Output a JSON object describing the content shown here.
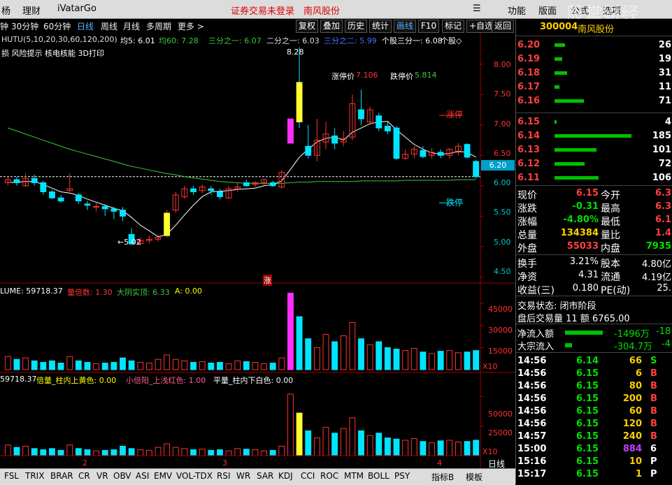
{
  "window": {
    "menu_left": [
      "杨",
      "理财",
      "iVatarGo"
    ],
    "menu_center": [
      "证券交易未登录",
      "南风股份"
    ],
    "menu_right": [
      "功能",
      "版面",
      "公式",
      "选项"
    ],
    "watermark": "股掌财经"
  },
  "toolbar": {
    "periods": [
      "钟",
      "30分钟",
      "60分钟",
      "日线",
      "周线",
      "月线",
      "多周期",
      "更多 >"
    ],
    "active_period": "日线",
    "buttons": [
      "复权",
      "叠加",
      "历史",
      "统计",
      "画线",
      "F10",
      "标记",
      "+自选",
      "返回"
    ],
    "active_button": "画线"
  },
  "main_chart": {
    "indicator_line": "HUTU(5,10,20,30,60,120,200)",
    "ma5": "均5: 6.01",
    "ma60": "均60: 7.28",
    "third1": "三分之一: 6.07",
    "third2": "二分之一: 6.03",
    "third3": "三分之二: 5.99",
    "individual": "个股三分一: 6.08",
    "individual2": "个股◇",
    "risk_line": "损 风险提示 核电核能 3D打印",
    "limit_up_price_label": "涨停价",
    "limit_up_price": "7.106",
    "limit_down_price_label": "跌停价",
    "limit_down_price": "5.814",
    "high_label": "8.28",
    "low_label": "←5.02",
    "limit_up_tag": "涨停",
    "limit_down_tag": "跌停",
    "current_price_tag": "6.20",
    "zhang_tag": "涨",
    "y_ticks": [
      "8.00",
      "7.50",
      "7.00",
      "6.50",
      "6.00",
      "5.50",
      "5.00",
      "4.50"
    ]
  },
  "volume_chart": {
    "title": "LUME: 59718.37",
    "multiple": "量倍数: 1.30",
    "real_body": "大阴实顶: 6.33",
    "a": "A: 0.00",
    "y_ticks": [
      "45000",
      "30000",
      "15000"
    ],
    "unit": "X10"
  },
  "third_chart": {
    "title": "59718.37",
    "beiliang": "倍量_柱内上黄色: 0.00",
    "xiaobei": "小倍阳_上浅红色: 1.00",
    "pingliang": "平量_柱内下白色: 0.00",
    "y_ticks": [
      "50000",
      "25000"
    ],
    "unit": "X10",
    "month_marks": [
      "2",
      "3",
      "4"
    ],
    "daily_label": "日线"
  },
  "bottom_tabs": [
    "FSL",
    "TRIX",
    "BRAR",
    "CR",
    "VR",
    "OBV",
    "ASI",
    "EMV",
    "VOL-TDX",
    "RSI",
    "WR",
    "SAR",
    "KDJ",
    "CCI",
    "ROC",
    "MTM",
    "BOLL",
    "PSY",
    "指标B",
    "模板"
  ],
  "quote": {
    "code": "300004",
    "name": "南风股份",
    "sell": [
      {
        "price": "6.20",
        "vol": "26"
      },
      {
        "price": "6.19",
        "vol": "19"
      },
      {
        "price": "6.18",
        "vol": "31"
      },
      {
        "price": "6.17",
        "vol": "11"
      },
      {
        "price": "6.16",
        "vol": "71"
      }
    ],
    "buy": [
      {
        "price": "6.15",
        "vol": "4"
      },
      {
        "price": "6.14",
        "vol": "185"
      },
      {
        "price": "6.13",
        "vol": "101"
      },
      {
        "price": "6.12",
        "vol": "72"
      },
      {
        "price": "6.11",
        "vol": "106"
      }
    ],
    "stats": [
      {
        "k1": "现价",
        "v1": "6.15",
        "k2": "今开",
        "v2": "6.3"
      },
      {
        "k1": "涨跌",
        "v1": "-0.31",
        "k2": "最高",
        "v2": "6.3"
      },
      {
        "k1": "涨幅",
        "v1": "-4.80%",
        "k2": "最低",
        "v2": "6.1"
      },
      {
        "k1": "总量",
        "v1": "134384",
        "k2": "量比",
        "v2": "1.4"
      },
      {
        "k1": "外盘",
        "v1": "55033",
        "k2": "内盘",
        "v2": "7935"
      }
    ],
    "stats2": [
      {
        "k1": "换手",
        "v1": "3.21%",
        "k2": "股本",
        "v2": "4.80亿"
      },
      {
        "k1": "净资",
        "v1": "4.31",
        "k2": "流通",
        "v2": "4.19亿"
      },
      {
        "k1": "收益(三)",
        "v1": "0.180",
        "k2": "PE(动)",
        "v2": "25."
      }
    ],
    "status": "交易状态: 闭市阶段",
    "after_hours": "盘后交易量 11 额 6765.00",
    "net_inflow_label": "净流入额",
    "net_inflow": "-1496万",
    "net_inflow2": "-18",
    "block_label": "大宗流入",
    "block_inflow": "-304.7万",
    "block_inflow2": "-4",
    "ticks": [
      {
        "t": "14:56",
        "p": "6.14",
        "v": "66",
        "s": "S"
      },
      {
        "t": "14:56",
        "p": "6.15",
        "v": "6",
        "s": "B"
      },
      {
        "t": "14:56",
        "p": "6.15",
        "v": "80",
        "s": "B"
      },
      {
        "t": "14:56",
        "p": "6.15",
        "v": "200",
        "s": "B"
      },
      {
        "t": "14:56",
        "p": "6.15",
        "v": "60",
        "s": "B"
      },
      {
        "t": "14:56",
        "p": "6.15",
        "v": "120",
        "s": "B"
      },
      {
        "t": "14:57",
        "p": "6.15",
        "v": "240",
        "s": "B"
      },
      {
        "t": "15:00",
        "p": "6.15",
        "v": "884",
        "s": "6"
      },
      {
        "t": "15:16",
        "p": "6.15",
        "v": "10",
        "s": "P"
      },
      {
        "t": "15:17",
        "p": "6.15",
        "v": "1",
        "s": "P"
      }
    ]
  },
  "colors": {
    "up": "#ff3232",
    "down": "#00e5ff",
    "ma_white": "#ffffff",
    "ma_green": "#3cc83c",
    "price_red": "#ff4040",
    "price_green": "#00d000",
    "bar_green": "#00c000"
  },
  "chart_data": {
    "type": "candlestick",
    "candles": [
      {
        "o": 6.05,
        "c": 6.1,
        "h": 6.15,
        "l": 6.0
      },
      {
        "o": 6.1,
        "c": 6.05,
        "h": 6.15,
        "l": 6.0
      },
      {
        "o": 6.0,
        "c": 6.12,
        "h": 6.2,
        "l": 5.98
      },
      {
        "o": 6.12,
        "c": 6.05,
        "h": 6.18,
        "l": 6.0
      },
      {
        "o": 6.05,
        "c": 5.9,
        "h": 6.08,
        "l": 5.85
      },
      {
        "o": 5.9,
        "c": 5.8,
        "h": 5.93,
        "l": 5.78
      },
      {
        "o": 5.8,
        "c": 5.75,
        "h": 5.85,
        "l": 5.72
      },
      {
        "o": 5.92,
        "c": 5.95,
        "h": 6.2,
        "l": 5.9
      },
      {
        "o": 5.85,
        "c": 5.75,
        "h": 5.88,
        "l": 5.7
      },
      {
        "o": 5.7,
        "c": 5.68,
        "h": 5.75,
        "l": 5.6
      },
      {
        "o": 5.65,
        "c": 5.66,
        "h": 5.72,
        "l": 5.58
      },
      {
        "o": 5.66,
        "c": 5.62,
        "h": 5.7,
        "l": 5.5
      },
      {
        "o": 5.62,
        "c": 5.58,
        "h": 5.65,
        "l": 5.45
      },
      {
        "o": 5.6,
        "c": 5.5,
        "h": 5.65,
        "l": 5.42
      },
      {
        "o": 5.2,
        "c": 5.05,
        "h": 5.3,
        "l": 5.02
      },
      {
        "o": 5.05,
        "c": 5.1,
        "h": 5.15,
        "l": 5.02
      },
      {
        "o": 5.1,
        "c": 5.12,
        "h": 5.18,
        "l": 5.05
      },
      {
        "o": 5.12,
        "c": 5.15,
        "h": 5.2,
        "l": 5.08
      },
      {
        "o": 5.18,
        "c": 5.55,
        "h": 5.6,
        "l": 5.15
      },
      {
        "o": 5.6,
        "c": 5.85,
        "h": 5.9,
        "l": 5.55
      },
      {
        "o": 5.82,
        "c": 5.95,
        "h": 6.0,
        "l": 5.78
      },
      {
        "o": 5.95,
        "c": 5.9,
        "h": 6.0,
        "l": 5.85
      },
      {
        "o": 5.92,
        "c": 5.98,
        "h": 6.02,
        "l": 5.88
      },
      {
        "o": 5.95,
        "c": 5.92,
        "h": 6.0,
        "l": 5.85
      },
      {
        "o": 5.9,
        "c": 5.82,
        "h": 5.95,
        "l": 5.78
      },
      {
        "o": 5.8,
        "c": 5.95,
        "h": 6.0,
        "l": 5.78
      },
      {
        "o": 5.95,
        "c": 5.98,
        "h": 6.05,
        "l": 5.9
      },
      {
        "o": 6.05,
        "c": 6.0,
        "h": 6.1,
        "l": 5.98
      },
      {
        "o": 6.02,
        "c": 6.05,
        "h": 6.08,
        "l": 5.98
      },
      {
        "o": 6.05,
        "c": 6.1,
        "h": 6.12,
        "l": 6.0
      },
      {
        "o": 6.05,
        "c": 6.0,
        "h": 6.08,
        "l": 5.98
      },
      {
        "o": 5.98,
        "c": 6.22,
        "h": 6.25,
        "l": 5.95
      },
      {
        "o": 6.7,
        "c": 7.1,
        "h": 7.1,
        "l": 6.7
      },
      {
        "o": 7.7,
        "c": 7.05,
        "h": 8.28,
        "l": 6.95
      },
      {
        "o": 6.65,
        "c": 6.5,
        "h": 7.0,
        "l": 6.45
      },
      {
        "o": 6.5,
        "c": 6.75,
        "h": 7.1,
        "l": 6.4
      },
      {
        "o": 6.72,
        "c": 6.85,
        "h": 7.05,
        "l": 6.6
      },
      {
        "o": 6.82,
        "c": 6.7,
        "h": 6.95,
        "l": 6.6
      },
      {
        "o": 6.72,
        "c": 6.78,
        "h": 6.9,
        "l": 6.65
      },
      {
        "o": 6.8,
        "c": 7.35,
        "h": 7.5,
        "l": 6.75
      },
      {
        "o": 7.25,
        "c": 7.1,
        "h": 7.58,
        "l": 7.0
      },
      {
        "o": 7.05,
        "c": 7.25,
        "h": 7.3,
        "l": 7.0
      },
      {
        "o": 7.15,
        "c": 6.95,
        "h": 7.2,
        "l": 6.9
      },
      {
        "o": 6.98,
        "c": 6.9,
        "h": 7.05,
        "l": 6.85
      },
      {
        "o": 6.95,
        "c": 6.45,
        "h": 6.98,
        "l": 6.42
      },
      {
        "o": 6.45,
        "c": 6.52,
        "h": 6.6,
        "l": 6.42
      },
      {
        "o": 6.52,
        "c": 6.6,
        "h": 6.65,
        "l": 6.45
      },
      {
        "o": 6.58,
        "c": 6.48,
        "h": 6.65,
        "l": 6.45
      },
      {
        "o": 6.5,
        "c": 6.55,
        "h": 6.62,
        "l": 6.45
      },
      {
        "o": 6.55,
        "c": 6.5,
        "h": 6.6,
        "l": 6.45
      },
      {
        "o": 6.5,
        "c": 6.6,
        "h": 6.62,
        "l": 6.45
      },
      {
        "o": 6.55,
        "c": 6.65,
        "h": 6.7,
        "l": 6.5
      },
      {
        "o": 6.68,
        "c": 6.47,
        "h": 6.7,
        "l": 6.45
      },
      {
        "o": 6.4,
        "c": 6.15,
        "h": 6.42,
        "l": 6.12
      }
    ],
    "ma5": [
      6.05,
      6.06,
      6.07,
      6.07,
      6.02,
      5.96,
      5.9,
      5.88,
      5.84,
      5.78,
      5.73,
      5.68,
      5.63,
      5.59,
      5.48,
      5.35,
      5.26,
      5.16,
      5.2,
      5.35,
      5.52,
      5.68,
      5.82,
      5.9,
      5.91,
      5.92,
      5.94,
      5.95,
      5.96,
      6.0,
      6.02,
      6.08,
      6.27,
      6.47,
      6.6,
      6.72,
      6.78,
      6.8,
      6.75,
      6.88,
      6.95,
      7.02,
      7.05,
      7.06,
      6.92,
      6.8,
      6.68,
      6.6,
      6.54,
      6.52,
      6.53,
      6.57,
      6.55,
      6.47
    ],
    "ma60": [
      6.95,
      6.9,
      6.85,
      6.8,
      6.75,
      6.7,
      6.65,
      6.6,
      6.56,
      6.52,
      6.48,
      6.44,
      6.4,
      6.36,
      6.32,
      6.29,
      6.26,
      6.23,
      6.2,
      6.18,
      6.15,
      6.13,
      6.11,
      6.09,
      6.07,
      6.06,
      6.05,
      6.04,
      6.04,
      6.04,
      6.04,
      6.04,
      6.05,
      6.06,
      6.06,
      6.07,
      6.07,
      6.07,
      6.07,
      6.07,
      6.08,
      6.08,
      6.08,
      6.08,
      6.08,
      6.09,
      6.09,
      6.09,
      6.09,
      6.09,
      6.09,
      6.1,
      6.1,
      6.1
    ],
    "volume": [
      9000,
      7000,
      8000,
      6000,
      5000,
      6000,
      4500,
      9000,
      6000,
      5000,
      4000,
      4500,
      5000,
      8000,
      6000,
      5000,
      4500,
      7000,
      10000,
      7000,
      6000,
      5000,
      5500,
      4500,
      5000,
      4000,
      6000,
      5500,
      5000,
      4000,
      4500,
      8000,
      52000,
      36000,
      21000,
      15000,
      24000,
      19000,
      23000,
      32000,
      21000,
      17000,
      19000,
      15000,
      14000,
      13000,
      14500,
      12000,
      11000,
      12500,
      13000,
      11500,
      12000,
      13000,
      9000
    ],
    "ylim": [
      4.4,
      8.4
    ]
  }
}
